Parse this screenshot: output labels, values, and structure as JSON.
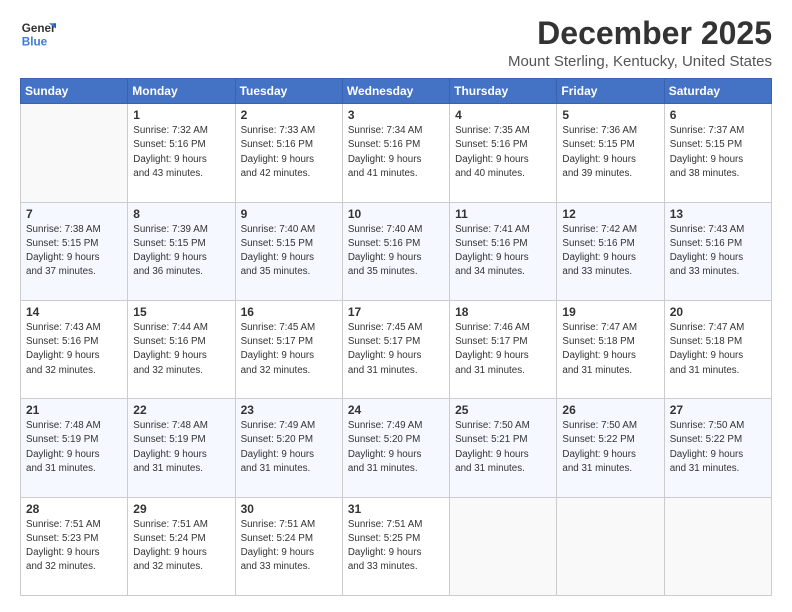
{
  "logo": {
    "general": "General",
    "blue": "Blue"
  },
  "title": "December 2025",
  "subtitle": "Mount Sterling, Kentucky, United States",
  "weekdays": [
    "Sunday",
    "Monday",
    "Tuesday",
    "Wednesday",
    "Thursday",
    "Friday",
    "Saturday"
  ],
  "weeks": [
    [
      {
        "num": "",
        "sunrise": "",
        "sunset": "",
        "daylight": "",
        "empty": true
      },
      {
        "num": "1",
        "sunrise": "7:32 AM",
        "sunset": "5:16 PM",
        "hours": "9",
        "minutes": "43"
      },
      {
        "num": "2",
        "sunrise": "7:33 AM",
        "sunset": "5:16 PM",
        "hours": "9",
        "minutes": "42"
      },
      {
        "num": "3",
        "sunrise": "7:34 AM",
        "sunset": "5:16 PM",
        "hours": "9",
        "minutes": "41"
      },
      {
        "num": "4",
        "sunrise": "7:35 AM",
        "sunset": "5:16 PM",
        "hours": "9",
        "minutes": "40"
      },
      {
        "num": "5",
        "sunrise": "7:36 AM",
        "sunset": "5:15 PM",
        "hours": "9",
        "minutes": "39"
      },
      {
        "num": "6",
        "sunrise": "7:37 AM",
        "sunset": "5:15 PM",
        "hours": "9",
        "minutes": "38"
      }
    ],
    [
      {
        "num": "7",
        "sunrise": "7:38 AM",
        "sunset": "5:15 PM",
        "hours": "9",
        "minutes": "37"
      },
      {
        "num": "8",
        "sunrise": "7:39 AM",
        "sunset": "5:15 PM",
        "hours": "9",
        "minutes": "36"
      },
      {
        "num": "9",
        "sunrise": "7:40 AM",
        "sunset": "5:15 PM",
        "hours": "9",
        "minutes": "35"
      },
      {
        "num": "10",
        "sunrise": "7:40 AM",
        "sunset": "5:16 PM",
        "hours": "9",
        "minutes": "35"
      },
      {
        "num": "11",
        "sunrise": "7:41 AM",
        "sunset": "5:16 PM",
        "hours": "9",
        "minutes": "34"
      },
      {
        "num": "12",
        "sunrise": "7:42 AM",
        "sunset": "5:16 PM",
        "hours": "9",
        "minutes": "33"
      },
      {
        "num": "13",
        "sunrise": "7:43 AM",
        "sunset": "5:16 PM",
        "hours": "9",
        "minutes": "33"
      }
    ],
    [
      {
        "num": "14",
        "sunrise": "7:43 AM",
        "sunset": "5:16 PM",
        "hours": "9",
        "minutes": "32"
      },
      {
        "num": "15",
        "sunrise": "7:44 AM",
        "sunset": "5:16 PM",
        "hours": "9",
        "minutes": "32"
      },
      {
        "num": "16",
        "sunrise": "7:45 AM",
        "sunset": "5:17 PM",
        "hours": "9",
        "minutes": "32"
      },
      {
        "num": "17",
        "sunrise": "7:45 AM",
        "sunset": "5:17 PM",
        "hours": "9",
        "minutes": "31"
      },
      {
        "num": "18",
        "sunrise": "7:46 AM",
        "sunset": "5:17 PM",
        "hours": "9",
        "minutes": "31"
      },
      {
        "num": "19",
        "sunrise": "7:47 AM",
        "sunset": "5:18 PM",
        "hours": "9",
        "minutes": "31"
      },
      {
        "num": "20",
        "sunrise": "7:47 AM",
        "sunset": "5:18 PM",
        "hours": "9",
        "minutes": "31"
      }
    ],
    [
      {
        "num": "21",
        "sunrise": "7:48 AM",
        "sunset": "5:19 PM",
        "hours": "9",
        "minutes": "31"
      },
      {
        "num": "22",
        "sunrise": "7:48 AM",
        "sunset": "5:19 PM",
        "hours": "9",
        "minutes": "31"
      },
      {
        "num": "23",
        "sunrise": "7:49 AM",
        "sunset": "5:20 PM",
        "hours": "9",
        "minutes": "31"
      },
      {
        "num": "24",
        "sunrise": "7:49 AM",
        "sunset": "5:20 PM",
        "hours": "9",
        "minutes": "31"
      },
      {
        "num": "25",
        "sunrise": "7:50 AM",
        "sunset": "5:21 PM",
        "hours": "9",
        "minutes": "31"
      },
      {
        "num": "26",
        "sunrise": "7:50 AM",
        "sunset": "5:22 PM",
        "hours": "9",
        "minutes": "31"
      },
      {
        "num": "27",
        "sunrise": "7:50 AM",
        "sunset": "5:22 PM",
        "hours": "9",
        "minutes": "31"
      }
    ],
    [
      {
        "num": "28",
        "sunrise": "7:51 AM",
        "sunset": "5:23 PM",
        "hours": "9",
        "minutes": "32"
      },
      {
        "num": "29",
        "sunrise": "7:51 AM",
        "sunset": "5:24 PM",
        "hours": "9",
        "minutes": "32"
      },
      {
        "num": "30",
        "sunrise": "7:51 AM",
        "sunset": "5:24 PM",
        "hours": "9",
        "minutes": "33"
      },
      {
        "num": "31",
        "sunrise": "7:51 AM",
        "sunset": "5:25 PM",
        "hours": "9",
        "minutes": "33"
      },
      {
        "num": "",
        "sunrise": "",
        "sunset": "",
        "hours": "",
        "minutes": "",
        "empty": true
      },
      {
        "num": "",
        "sunrise": "",
        "sunset": "",
        "hours": "",
        "minutes": "",
        "empty": true
      },
      {
        "num": "",
        "sunrise": "",
        "sunset": "",
        "hours": "",
        "minutes": "",
        "empty": true
      }
    ]
  ],
  "labels": {
    "sunrise": "Sunrise:",
    "sunset": "Sunset:",
    "daylight": "Daylight:",
    "hours_label": "hours",
    "and": "and",
    "minutes_label": "minutes."
  }
}
